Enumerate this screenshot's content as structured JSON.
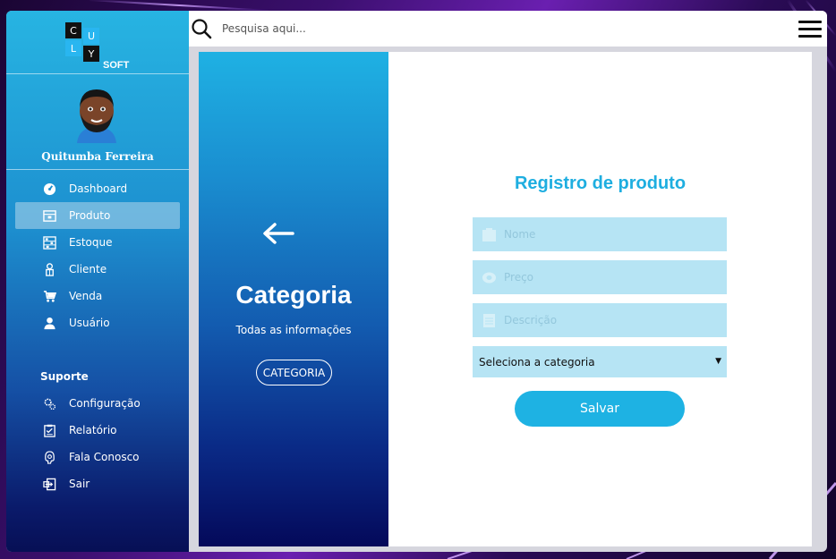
{
  "brand": {
    "logo_letters": [
      "C",
      "U",
      "L",
      "Y"
    ],
    "logo_suffix": "SOFT"
  },
  "user": {
    "name": "Quitumba Ferreira"
  },
  "sidebar": {
    "items": [
      {
        "label": "Dashboard",
        "icon": "dashboard-icon",
        "active": false
      },
      {
        "label": "Produto",
        "icon": "product-icon",
        "active": true
      },
      {
        "label": "Estoque",
        "icon": "stock-icon",
        "active": false
      },
      {
        "label": "Cliente",
        "icon": "client-icon",
        "active": false
      },
      {
        "label": "Venda",
        "icon": "cart-icon",
        "active": false
      },
      {
        "label": "Usuário",
        "icon": "user-icon",
        "active": false
      }
    ],
    "support_title": "Suporte",
    "support_items": [
      {
        "label": "Configuração",
        "icon": "gear-icon"
      },
      {
        "label": "Relatório",
        "icon": "report-icon"
      },
      {
        "label": "Fala Conosco",
        "icon": "headset-icon"
      },
      {
        "label": "Sair",
        "icon": "logout-icon"
      }
    ]
  },
  "topbar": {
    "search_placeholder": "Pesquisa aqui..."
  },
  "category_panel": {
    "title": "Categoria",
    "subtitle": "Todas as informações",
    "button_label": "CATEGORIA"
  },
  "form": {
    "title": "Registro de produto",
    "name_placeholder": "Nome",
    "price_placeholder": "Preço",
    "description_placeholder": "Descrição",
    "category_select": "Seleciona a categoria",
    "save_label": "Salvar"
  },
  "colors": {
    "accent": "#1eb2e3",
    "field_bg": "#b6e4f4",
    "sidebar_top": "#27b4e2",
    "sidebar_bottom": "#070f55"
  }
}
